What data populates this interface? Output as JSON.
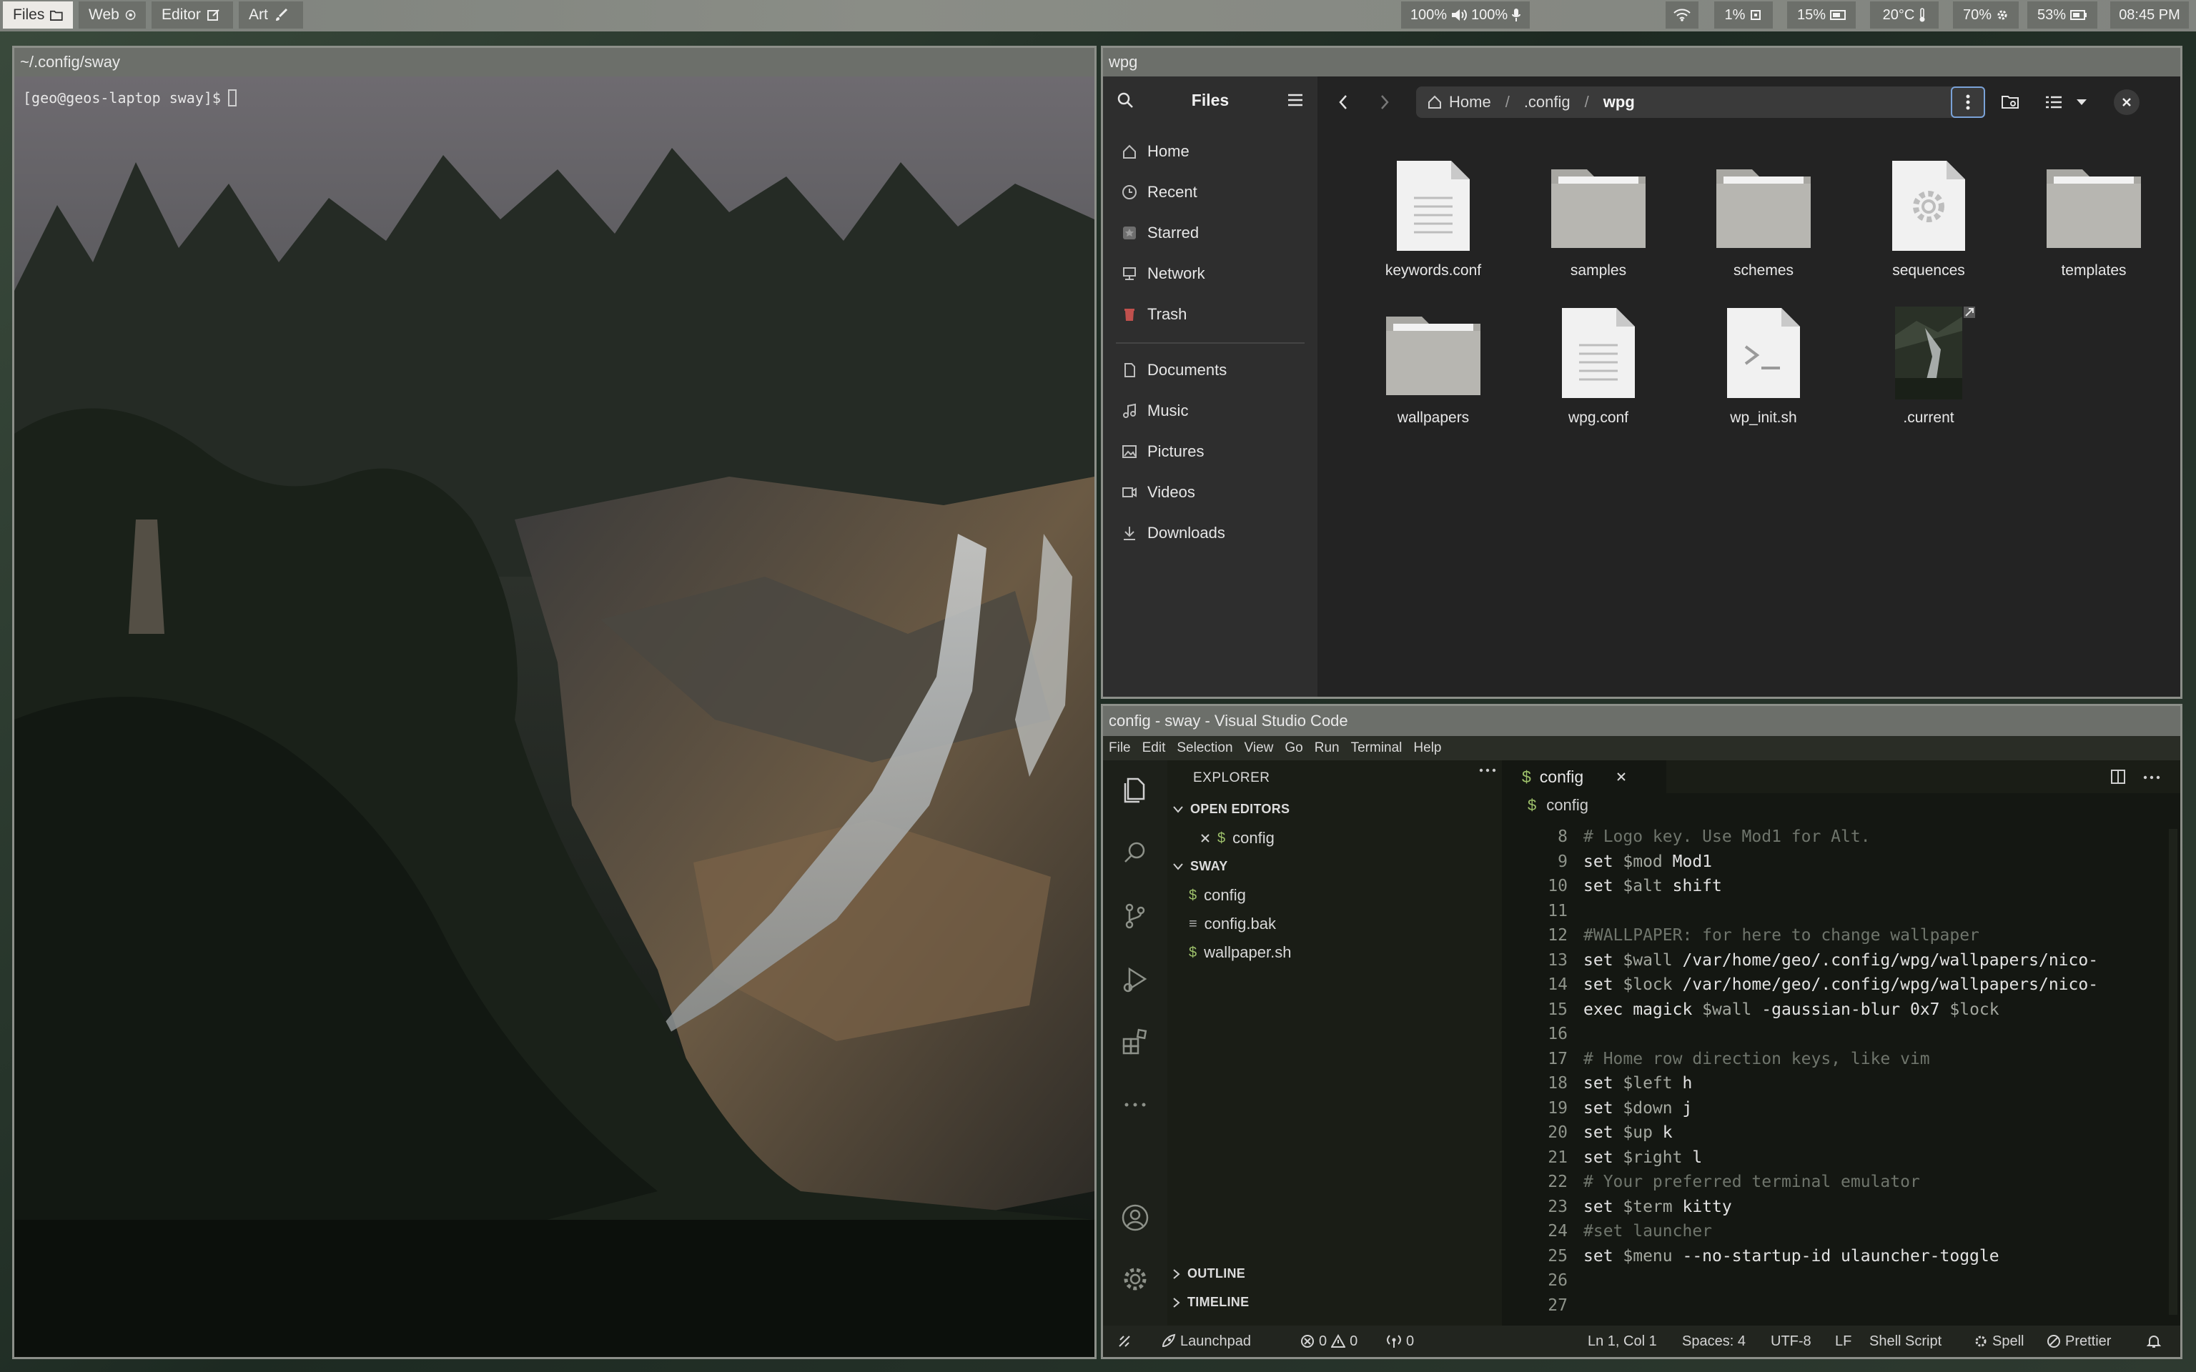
{
  "topbar": {
    "workspaces": [
      {
        "label": "Files",
        "icon": "folder-icon",
        "active": true
      },
      {
        "label": "Web",
        "icon": "globe-icon",
        "active": false
      },
      {
        "label": "Editor",
        "icon": "edit-icon",
        "active": false
      },
      {
        "label": "Art",
        "icon": "brush-icon",
        "active": false
      }
    ],
    "audio": {
      "volume": "100%",
      "mic": "100%"
    },
    "cpu": "1%",
    "backlight": "15%",
    "temperature": "20°C",
    "memory": "70%",
    "battery": "53%",
    "clock": "08:45 PM"
  },
  "terminal": {
    "title": "~/.config/sway",
    "prompt": "[geo@geos-laptop sway]$"
  },
  "files": {
    "window_title": "wpg",
    "sidebar_title": "Files",
    "places": [
      {
        "label": "Home",
        "icon": "home-icon"
      },
      {
        "label": "Recent",
        "icon": "clock-icon"
      },
      {
        "label": "Starred",
        "icon": "star-icon"
      },
      {
        "label": "Network",
        "icon": "network-icon"
      },
      {
        "label": "Trash",
        "icon": "trash-icon"
      }
    ],
    "bookmarks": [
      {
        "label": "Documents",
        "icon": "document-icon"
      },
      {
        "label": "Music",
        "icon": "music-icon"
      },
      {
        "label": "Pictures",
        "icon": "pictures-icon"
      },
      {
        "label": "Videos",
        "icon": "video-icon"
      },
      {
        "label": "Downloads",
        "icon": "download-icon"
      }
    ],
    "breadcrumb": [
      "Home",
      ".config",
      "wpg"
    ],
    "items": [
      {
        "name": "keywords.conf",
        "type": "text"
      },
      {
        "name": "samples",
        "type": "folder"
      },
      {
        "name": "schemes",
        "type": "folder"
      },
      {
        "name": "sequences",
        "type": "settings"
      },
      {
        "name": "templates",
        "type": "folder"
      },
      {
        "name": "wallpapers",
        "type": "folder"
      },
      {
        "name": "wpg.conf",
        "type": "text"
      },
      {
        "name": "wp_init.sh",
        "type": "script"
      },
      {
        "name": ".current",
        "type": "image-link"
      }
    ]
  },
  "vscode": {
    "title": "config - sway - Visual Studio Code",
    "menu": [
      "File",
      "Edit",
      "Selection",
      "View",
      "Go",
      "Run",
      "Terminal",
      "Help"
    ],
    "explorer": {
      "header": "EXPLORER",
      "open_editors_label": "OPEN EDITORS",
      "open_editors": [
        {
          "name": "config",
          "icon": "$"
        }
      ],
      "folder_label": "SWAY",
      "files": [
        {
          "name": "config",
          "icon": "$"
        },
        {
          "name": "config.bak",
          "icon": "≡"
        },
        {
          "name": "wallpaper.sh",
          "icon": "$"
        }
      ],
      "outline_label": "OUTLINE",
      "timeline_label": "TIMELINE"
    },
    "tab": {
      "name": "config",
      "icon": "$"
    },
    "breadcrumb": {
      "name": "config",
      "icon": "$"
    },
    "code": [
      {
        "n": "8",
        "kind": "comment",
        "text": "# Logo key. Use Mod1 for Alt."
      },
      {
        "n": "9",
        "kind": "set",
        "cmd": "set ",
        "var": "$mod",
        "rest": " Mod1"
      },
      {
        "n": "10",
        "kind": "set",
        "cmd": "set ",
        "var": "$alt",
        "rest": " shift"
      },
      {
        "n": "11",
        "kind": "blank",
        "text": ""
      },
      {
        "n": "12",
        "kind": "comment",
        "text": "#WALLPAPER: for here to change wallpaper"
      },
      {
        "n": "13",
        "kind": "set",
        "cmd": "set ",
        "var": "$wall",
        "rest": " /var/home/geo/.config/wpg/wallpapers/nico-"
      },
      {
        "n": "14",
        "kind": "set",
        "cmd": "set ",
        "var": "$lock",
        "rest": " /var/home/geo/.config/wpg/wallpapers/nico-"
      },
      {
        "n": "15",
        "kind": "exec",
        "cmd": "exec magick ",
        "var": "$wall",
        "rest": " -gaussian-blur 0x7 ",
        "var2": "$lock"
      },
      {
        "n": "16",
        "kind": "blank",
        "text": ""
      },
      {
        "n": "17",
        "kind": "comment",
        "text": "# Home row direction keys, like vim"
      },
      {
        "n": "18",
        "kind": "set",
        "cmd": "set ",
        "var": "$left",
        "rest": " h"
      },
      {
        "n": "19",
        "kind": "set",
        "cmd": "set ",
        "var": "$down",
        "rest": " j"
      },
      {
        "n": "20",
        "kind": "set",
        "cmd": "set ",
        "var": "$up",
        "rest": " k"
      },
      {
        "n": "21",
        "kind": "set",
        "cmd": "set ",
        "var": "$right",
        "rest": " l"
      },
      {
        "n": "22",
        "kind": "comment",
        "text": "# Your preferred terminal emulator"
      },
      {
        "n": "23",
        "kind": "set",
        "cmd": "set ",
        "var": "$term",
        "rest": " kitty"
      },
      {
        "n": "24",
        "kind": "comment",
        "text": "#set launcher"
      },
      {
        "n": "25",
        "kind": "set",
        "cmd": "set ",
        "var": "$menu",
        "rest": " --no-startup-id ulauncher-toggle"
      },
      {
        "n": "26",
        "kind": "blank",
        "text": ""
      },
      {
        "n": "27",
        "kind": "blank",
        "text": ""
      }
    ],
    "status": {
      "launchpad": "Launchpad",
      "errors": "0",
      "warnings": "0",
      "ports": "0",
      "position": "Ln 1, Col 1",
      "spaces": "Spaces: 4",
      "encoding": "UTF-8",
      "eol": "LF",
      "language": "Shell Script",
      "spell": "Spell",
      "prettier": "Prettier"
    }
  },
  "colors": {
    "bar_bg": "#6c6f6a",
    "window_border": "#8c8f89",
    "files_bg": "#232323",
    "vscode_bg": "#141712",
    "accent": "#7aa2d8"
  }
}
